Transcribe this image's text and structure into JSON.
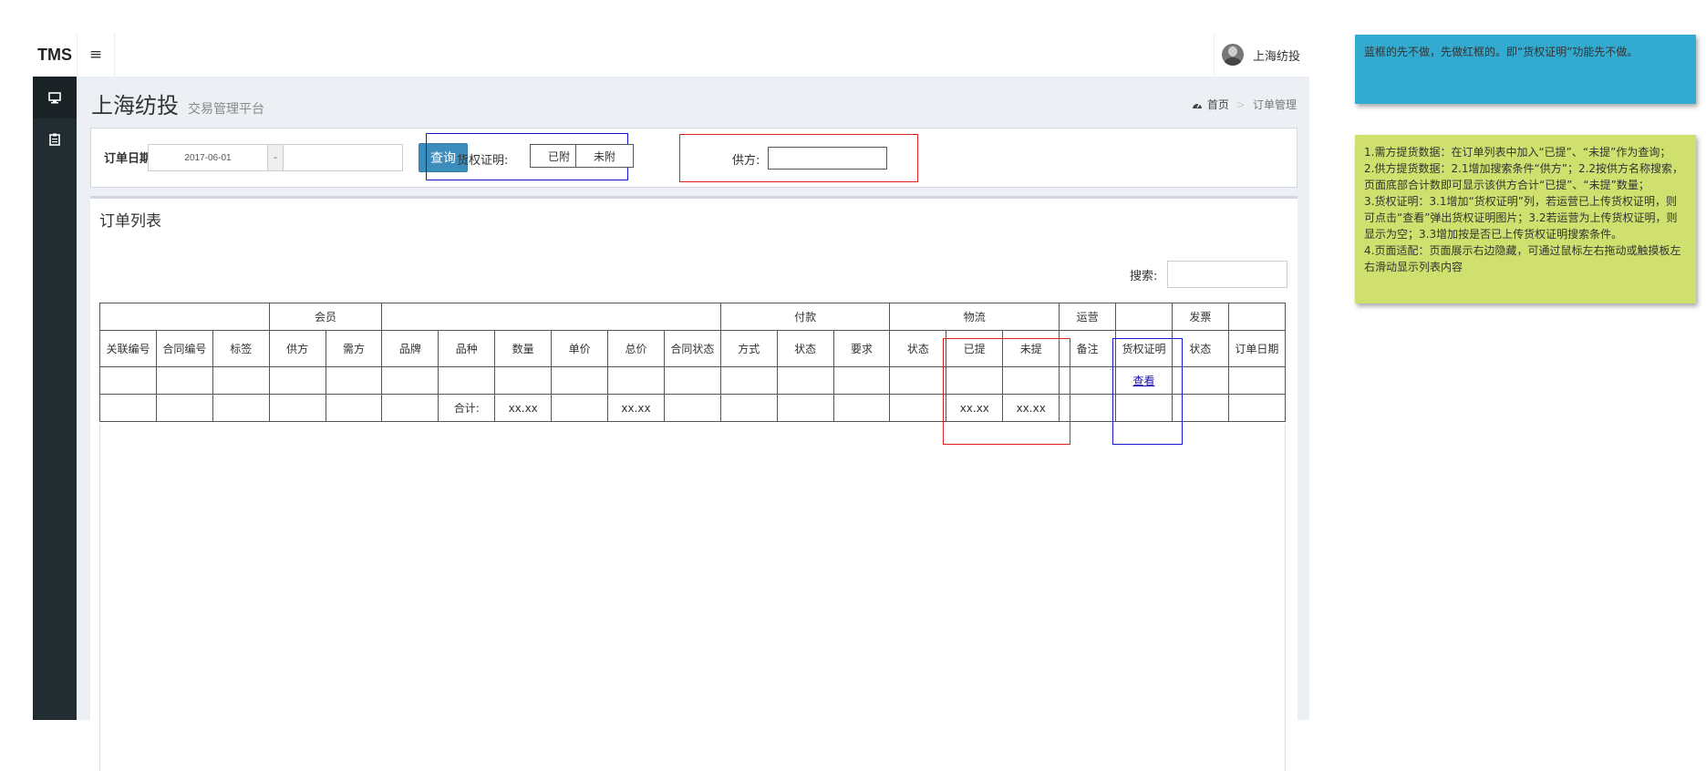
{
  "app": {
    "brand": "TMS",
    "menu_icon": "≡",
    "user": {
      "name": "上海纺投"
    }
  },
  "sidebar": {
    "items": [
      {
        "icon": "monitor-icon"
      },
      {
        "icon": "clipboard-icon"
      }
    ]
  },
  "page": {
    "title": "上海纺投",
    "subtitle": "交易管理平台",
    "breadcrumb": {
      "home": "首页",
      "current": "订单管理"
    }
  },
  "filter": {
    "date_label": "订单日期",
    "date_from": "2017-06-01",
    "date_sep": "-",
    "date_to": "",
    "query_button": "查询",
    "cert_label": "货权证明:",
    "cert_attached": "已附",
    "cert_not_attached": "未附",
    "supplier_label": "供方:",
    "supplier_value": ""
  },
  "order_list": {
    "title": "订单列表",
    "search_label": "搜索:",
    "search_value": "",
    "header_groups": [
      {
        "label": "",
        "span": 3
      },
      {
        "label": "会员",
        "span": 2
      },
      {
        "label": "",
        "span": 6
      },
      {
        "label": "付款",
        "span": 3
      },
      {
        "label": "物流",
        "span": 3
      },
      {
        "label": "运营",
        "span": 1
      },
      {
        "label": "",
        "span": 1
      },
      {
        "label": "发票",
        "span": 1
      },
      {
        "label": "",
        "span": 1
      }
    ],
    "columns": [
      "关联编号",
      "合同编号",
      "标签",
      "供方",
      "需方",
      "品牌",
      "品种",
      "数量",
      "单价",
      "总价",
      "合同状态",
      "方式",
      "状态",
      "要求",
      "状态",
      "已提",
      "未提",
      "备注",
      "货权证明",
      "状态",
      "订单日期"
    ],
    "rows": [
      [
        "",
        "",
        "",
        "",
        "",
        "",
        "",
        "",
        "",
        "",
        "",
        "",
        "",
        "",
        "",
        "",
        "",
        "",
        "查看",
        "",
        ""
      ]
    ],
    "view_link_col": 18,
    "total_row": [
      "",
      "",
      "",
      "",
      "",
      "",
      "合计:",
      "xx.xx",
      "",
      "xx.xx",
      "",
      "",
      "",
      "",
      "",
      "xx.xx",
      "xx.xx",
      "",
      "",
      "",
      ""
    ]
  },
  "notes": {
    "blue": "蓝框的先不做，先做红框的。即“货权证明”功能先不做。",
    "green": [
      "1.需方提货数据：在订单列表中加入“已提”、“未提”作为查询；",
      "2.供方提货数据：2.1增加搜索条件“供方”；2.2按供方名称搜索，页面底部合计数即可显示该供方合计“已提”、“未提”数量；",
      "3.货权证明：3.1增加“货权证明”列，若运营已上传货权证明，则可点击“查看”弹出货权证明图片；3.2若运营为上传货权证明，则显示为空；3.3增加按是否已上传货权证明搜索条件。",
      "4.页面适配：页面展示右边隐藏，可通过鼠标左右拖动或触摸板左右滑动显示列表内容"
    ]
  },
  "colors": {
    "sidebar": "#222d32",
    "primary": "#3c8dbc",
    "content_bg": "#ecf0f5",
    "annotation_red": "#e02020",
    "annotation_blue": "#1515d0",
    "note_blue": "#33aad0",
    "note_green": "#cfe06e"
  }
}
